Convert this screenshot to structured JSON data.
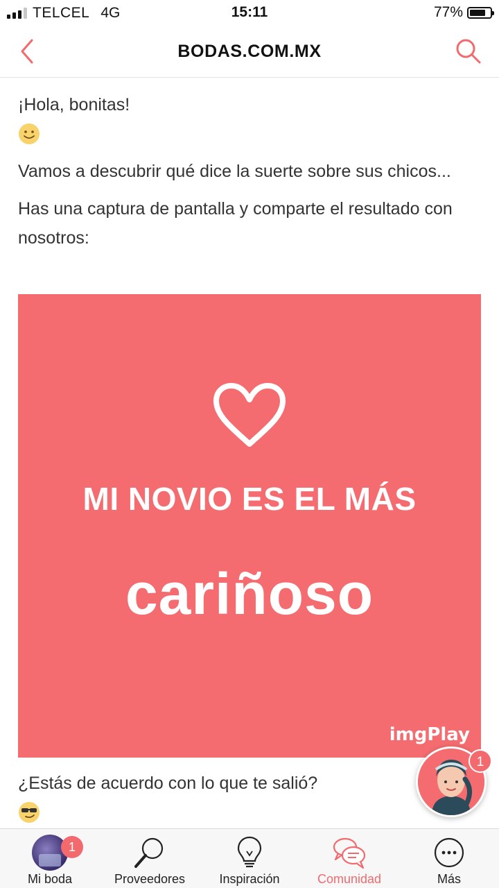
{
  "status_bar": {
    "carrier": "TELCEL",
    "network": "4G",
    "time": "15:11",
    "battery": "77%",
    "battery_level": 0.77
  },
  "header": {
    "title": "BODAS.COM.MX",
    "back_icon": "chevron-left-icon",
    "search_icon": "search-icon",
    "accent_color": "#f26a6d"
  },
  "post": {
    "greeting": "¡Hola, bonitas!",
    "greeting_emoji": "smiling-face-emoji",
    "paragraph_1": "Vamos a descubrir qué dice la suerte sobre sus chicos...",
    "paragraph_2": "Has una captura de pantalla y comparte el resultado con nosotros:",
    "image": {
      "line_1": "MI NOVIO ES EL MÁS",
      "line_2": "cariñoso",
      "watermark": "imgPlay",
      "background": "#f46c6f"
    },
    "question": "¿Estás de acuerdo con lo que te salió?",
    "question_emoji": "smirking-sunglasses-emoji"
  },
  "floating_assistant": {
    "badge": "1"
  },
  "tabbar": {
    "items": [
      {
        "label": "Mi boda",
        "icon": "avatar",
        "badge": "1"
      },
      {
        "label": "Proveedores",
        "icon": "magnifier-icon"
      },
      {
        "label": "Inspiración",
        "icon": "lightbulb-icon"
      },
      {
        "label": "Comunidad",
        "icon": "chat-bubbles-icon",
        "active": true
      },
      {
        "label": "Más",
        "icon": "more-icon"
      }
    ]
  }
}
